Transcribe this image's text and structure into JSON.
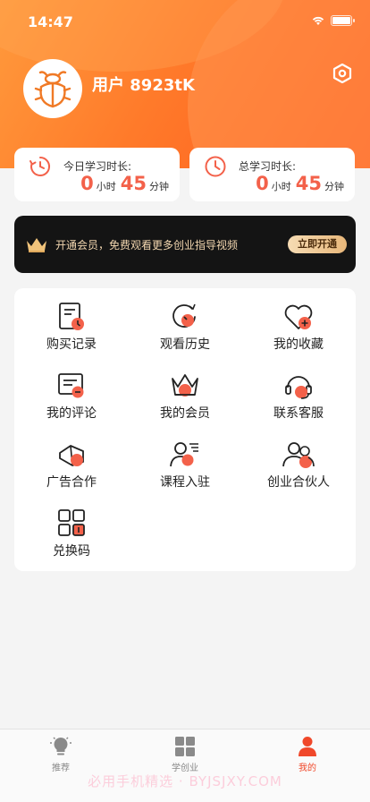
{
  "status_bar": {
    "time": "14:47"
  },
  "profile": {
    "username": "用户 8923tK"
  },
  "stats": {
    "today": {
      "label": "今日学习时长:",
      "hours": "0",
      "hours_unit": "小时",
      "minutes": "45",
      "minutes_unit": "分钟"
    },
    "total": {
      "label": "总学习时长:",
      "hours": "0",
      "hours_unit": "小时",
      "minutes": "45",
      "minutes_unit": "分钟"
    }
  },
  "vip_banner": {
    "text": "开通会员，免费观看更多创业指导视频",
    "button": "立即开通"
  },
  "menu": {
    "items": [
      {
        "label": "购买记录",
        "icon": "receipt-icon"
      },
      {
        "label": "观看历史",
        "icon": "history-icon"
      },
      {
        "label": "我的收藏",
        "icon": "heart-icon"
      },
      {
        "label": "我的评论",
        "icon": "comment-icon"
      },
      {
        "label": "我的会员",
        "icon": "crown-icon"
      },
      {
        "label": "联系客服",
        "icon": "headset-icon"
      },
      {
        "label": "广告合作",
        "icon": "megaphone-icon"
      },
      {
        "label": "课程入驻",
        "icon": "instructor-icon"
      },
      {
        "label": "创业合伙人",
        "icon": "partners-icon"
      },
      {
        "label": "兑换码",
        "icon": "grid-code-icon"
      }
    ]
  },
  "tabbar": {
    "tabs": [
      {
        "label": "推荐",
        "icon": "lightbulb-icon"
      },
      {
        "label": "学创业",
        "icon": "grid-icon"
      },
      {
        "label": "我的",
        "icon": "person-icon",
        "active": true
      }
    ]
  },
  "watermark": "必用手机精选 · BYJSJXY.COM",
  "colors": {
    "accent": "#f3614a",
    "header_start": "#ff9a3c",
    "header_end": "#ff5a1e",
    "tab_active": "#f0482a"
  }
}
